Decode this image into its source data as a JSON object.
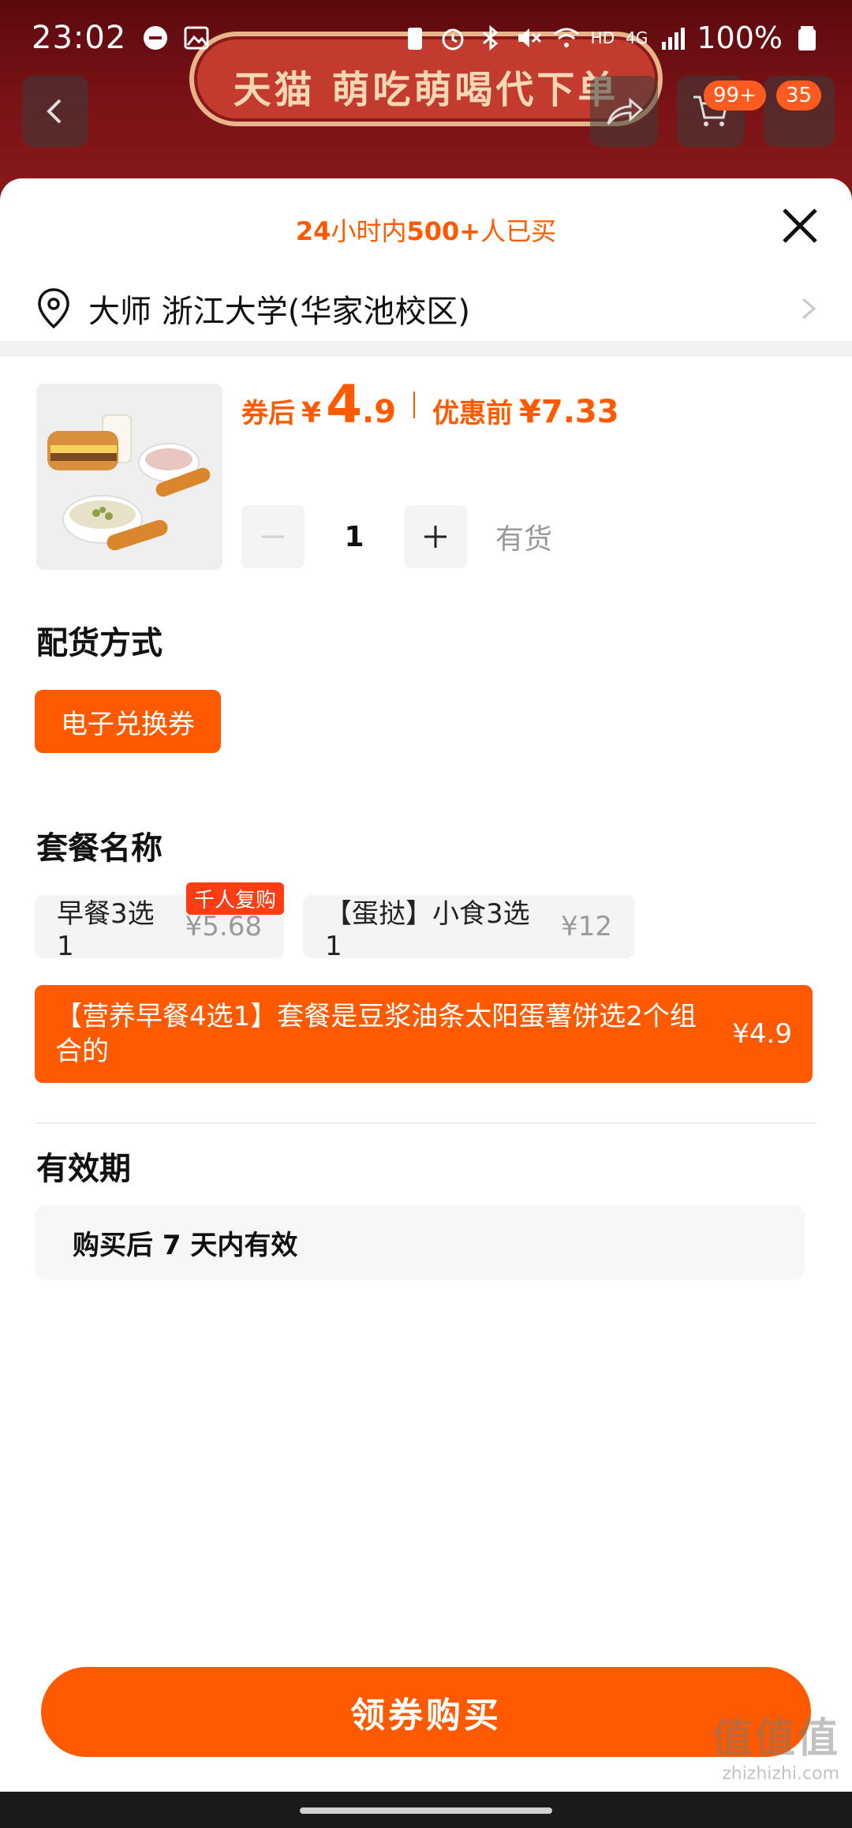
{
  "status_bar": {
    "time": "23:02",
    "network": "4G",
    "hd": "HD",
    "battery": "100%"
  },
  "background": {
    "banner_text": "天猫 萌吃萌喝代下单",
    "cart_badge": "99+",
    "more_badge": "35"
  },
  "sheet": {
    "sold_prefix": "24",
    "sold_mid": "小时内",
    "sold_count": "500+",
    "sold_suffix": "人已买",
    "address": "大师 浙江大学(华家池校区)"
  },
  "product": {
    "price_label": "券后",
    "currency": "¥",
    "price_int": "4",
    "price_dec": ".9",
    "orig_label": "优惠前",
    "orig_value": "¥7.33",
    "quantity": "1",
    "stock": "有货"
  },
  "delivery": {
    "title": "配货方式",
    "option": "电子兑换券"
  },
  "package": {
    "title": "套餐名称",
    "options": [
      {
        "name": "早餐3选1",
        "price": "¥5.68",
        "tag": "千人复购"
      },
      {
        "name": "【蛋挞】小食3选1",
        "price": "¥12"
      }
    ],
    "selected": {
      "name": "【营养早餐4选1】套餐是豆浆油条太阳蛋薯饼选2个组合的",
      "price": "¥4.9"
    }
  },
  "validity": {
    "title": "有效期",
    "value": "购买后 7 天内有效"
  },
  "buy_button": "领券购买",
  "watermark": {
    "logo": "值值值",
    "url": "zhizhizhi.com"
  },
  "colors": {
    "accent": "#ff5a00",
    "chip_bg": "#f4f4f4",
    "muted": "#999999"
  }
}
